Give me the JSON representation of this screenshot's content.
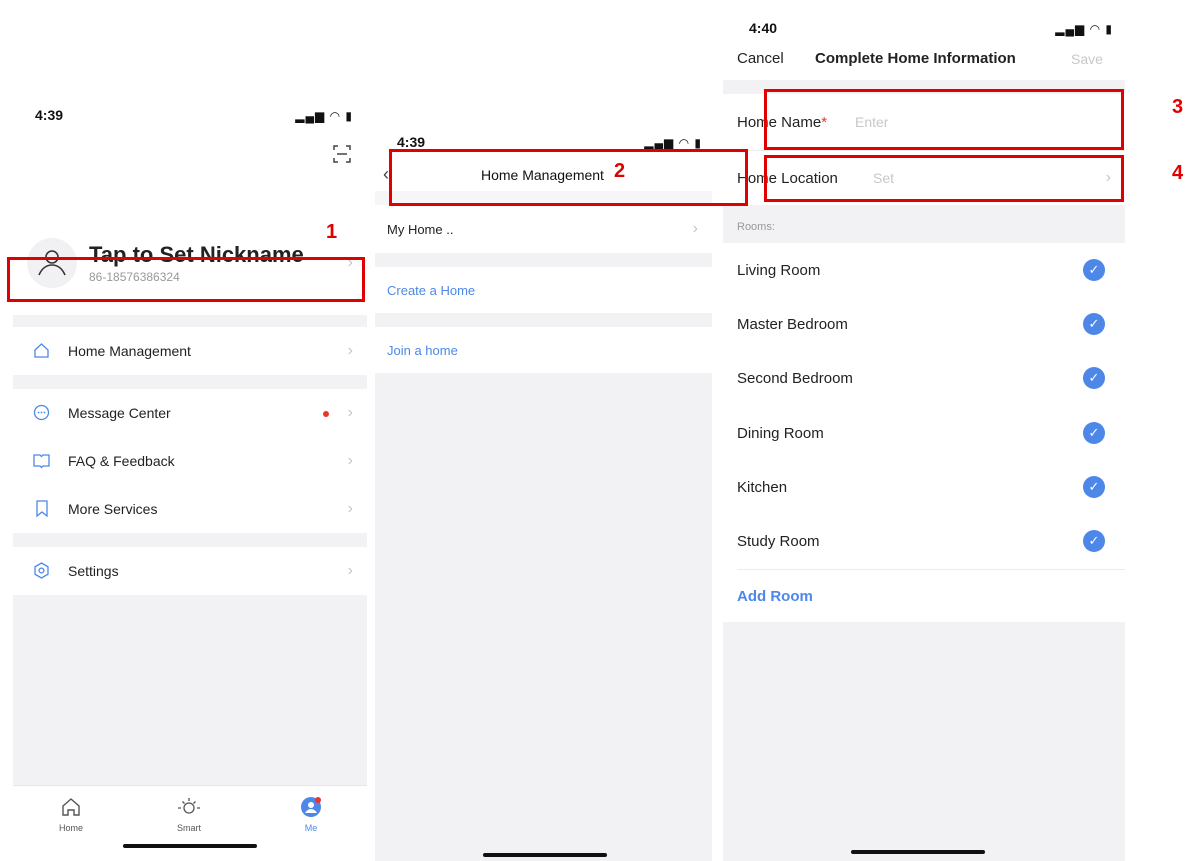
{
  "screen1": {
    "status_time": "4:39",
    "status_icons": "▂▄▆ ◠ ▮",
    "profile": {
      "nickname": "Tap to Set Nickname",
      "phone": "86-18576386324"
    },
    "menu": [
      {
        "label": "Home Management",
        "icon": "home-outline-icon"
      },
      {
        "label": "Message Center",
        "icon": "message-bubble-icon"
      },
      {
        "label": "FAQ & Feedback",
        "icon": "book-icon"
      },
      {
        "label": "More Services",
        "icon": "bookmark-icon"
      },
      {
        "label": "Settings",
        "icon": "settings-hexagon-icon"
      }
    ],
    "tabbar": [
      {
        "label": "Home",
        "icon": "home-tab-icon"
      },
      {
        "label": "Smart",
        "icon": "sun-icon"
      },
      {
        "label": "Me",
        "icon": "profile-tab-icon"
      }
    ]
  },
  "screen2": {
    "status_time": "4:39",
    "status_icons": "▂▄▆ ◠ ▮",
    "title": "Home Management",
    "items": {
      "my_home": "My Home ..",
      "create": "Create a Home",
      "join": "Join a home"
    }
  },
  "screen3": {
    "status_time": "4:40",
    "status_icons": "▂▄▆ ◠ ▮",
    "nav": {
      "cancel": "Cancel",
      "title": "Complete Home Information",
      "save": "Save"
    },
    "home_name_label": "Home Name",
    "required_mark": "*",
    "home_name_placeholder": "Enter",
    "home_location_label": "Home Location",
    "home_location_value": "Set",
    "rooms_header": "Rooms:",
    "rooms": [
      "Living Room",
      "Master Bedroom",
      "Second Bedroom",
      "Dining Room",
      "Kitchen",
      "Study Room"
    ],
    "add_room": "Add Room"
  },
  "annotations": {
    "n1": "1",
    "n2": "2",
    "n3": "3",
    "n4": "4"
  },
  "colors": {
    "accent": "#4d88e8",
    "annotation": "#e00000",
    "divider": "#f2f2f4"
  }
}
